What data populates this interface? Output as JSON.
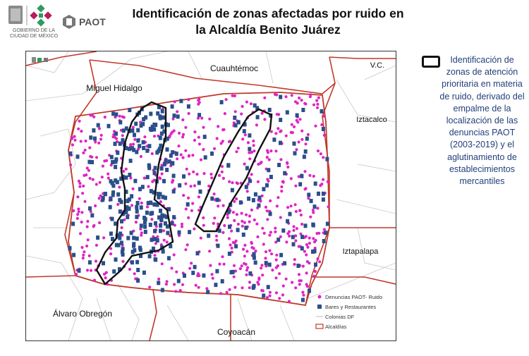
{
  "header": {
    "gov_logo_text": "GOBIERNO DE LA CIUDAD DE MÉXICO",
    "paot_label": "PAOT",
    "title_line1": "Identificación de zonas afectadas por ruido en",
    "title_line2": "la Alcaldía Benito Juárez"
  },
  "map": {
    "labels": {
      "north": "Cuauhtémoc",
      "northeast": "V.C.",
      "northwest": "Miguel Hidalgo",
      "east": "Iztacalco",
      "southeast": "Iztapalapa",
      "southwest": "Álvaro Obregón",
      "south": "Coyoacán"
    },
    "legend": {
      "complaints": "Denuncias PAOT- Ruido",
      "bars": "Bares y Restaurantes",
      "colonias": "Colonias DF",
      "alcaldias": "Alcaldías"
    },
    "colors": {
      "complaints": "#e024c4",
      "bars": "#2a4f8a",
      "alcaldias": "#c0392b",
      "colonias": "#bbbbbb",
      "zones": "#111111"
    }
  },
  "side_legend": {
    "text": "Identificación de zonas de atención prioritaria en materia de ruido, derivado del empalme de la localización de las denuncias PAOT (2003-2019) y el aglutinamiento de establecimientos mercantiles"
  }
}
